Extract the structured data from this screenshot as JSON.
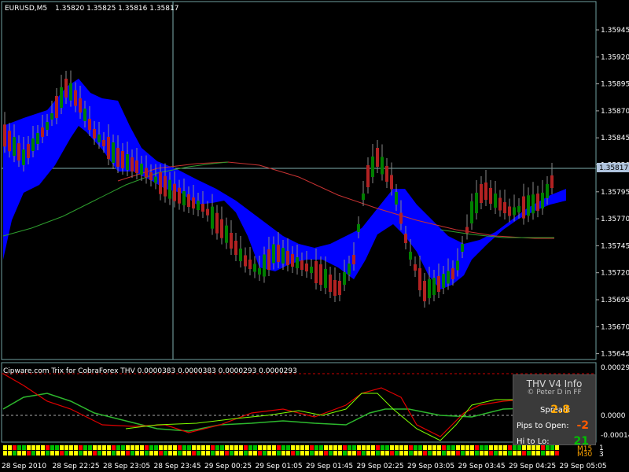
{
  "header": {
    "symbol_tf": "EURUSD,M5",
    "ohlc": "1.35820 1.35825 1.35816 1.35817",
    "indicator_caption": "Cipware.com Trix for CobraForex THV 0.0000383 0.0000383 0.0000293 0.0000293"
  },
  "price_axis": {
    "ticks": [
      "1.35945",
      "1.35920",
      "1.35895",
      "1.35870",
      "1.35845",
      "1.35820",
      "1.35795",
      "1.35770",
      "1.35745",
      "1.35720",
      "1.35695",
      "1.35670",
      "1.35645"
    ],
    "current_price": "1.35817"
  },
  "trix_axis": {
    "ticks": [
      "0.00029",
      "0.0000",
      "-0.00014"
    ],
    "level_top_label": "0.00029"
  },
  "time_axis": {
    "ticks": [
      "28 Sep 2010",
      "28 Sep 22:25",
      "28 Sep 23:05",
      "28 Sep 23:45",
      "29 Sep 00:25",
      "29 Sep 01:05",
      "29 Sep 01:45",
      "29 Sep 02:25",
      "29 Sep 03:05",
      "29 Sep 03:45",
      "29 Sep 04:25",
      "29 Sep 05:05"
    ]
  },
  "info_panel": {
    "title": "THV  V4  Info",
    "subtitle": "© Peter D in FF",
    "spread_label": "Spread:",
    "spread_value": "2.8",
    "pips_label": "Pips to Open:",
    "pips_value": "-2",
    "hilo_label": "Hi to Lo:",
    "hilo_value": "21"
  },
  "timeframe_strip": {
    "labels": [
      "M15",
      "M30"
    ],
    "right_values": [
      "1",
      "3"
    ]
  },
  "colors": {
    "bull": "#008000",
    "bear": "#b22222",
    "cloud": "#0000ff",
    "ma_red": "#c83232",
    "ma_green": "#2e9e2e",
    "grid": "#7fb0b0",
    "trix_green": "#2db82d",
    "trix_red": "#e00000",
    "trix_signal": "#7fff00",
    "spread_value": "#ffa500",
    "pips_value": "#ff5a00",
    "hilo_value": "#00c000"
  }
}
